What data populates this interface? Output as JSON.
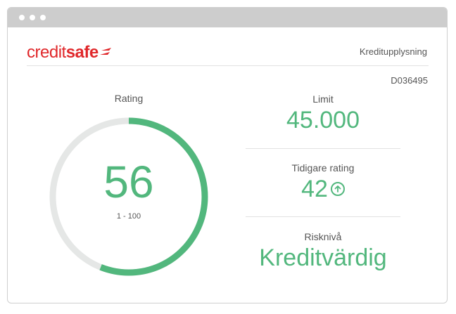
{
  "window": {
    "accent": "#52b77d",
    "brand_color": "#e0282b"
  },
  "brand": {
    "name_part1": "credit",
    "name_part2": "safe",
    "icon": "creditsafe-swoosh-icon"
  },
  "header": {
    "report_type": "Kreditupplysning",
    "report_id": "D036495"
  },
  "rating": {
    "label": "Rating",
    "value": "56",
    "range": "1 - 100",
    "score_fraction": 0.56
  },
  "limit": {
    "label": "Limit",
    "value": "45.000"
  },
  "previous_rating": {
    "label": "Tidigare rating",
    "value": "42",
    "trend_icon": "arrow-up-circle-icon"
  },
  "risk": {
    "label": "Risknivå",
    "value": "Kreditvärdig"
  }
}
